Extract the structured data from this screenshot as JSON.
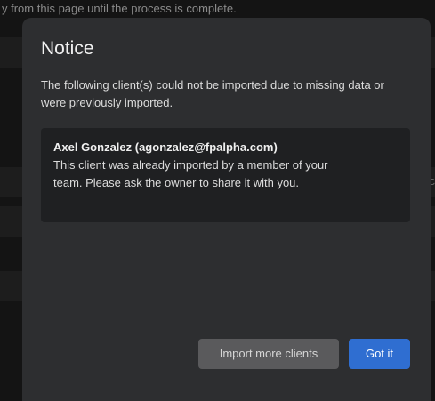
{
  "backdrop": {
    "top_text": "y from this page until the process is complete.",
    "edge_char": "c"
  },
  "modal": {
    "title": "Notice",
    "message": "The following client(s) could not be imported due to missing data or were previously imported.",
    "error": {
      "client": "Axel Gonzalez (agonzalez@fpalpha.com)",
      "detail": "This client was already imported by a member of your team. Please ask the owner to share it with you."
    },
    "buttons": {
      "import_more": "Import more clients",
      "got_it": "Got it"
    }
  },
  "colors": {
    "modal_background": "#2d2e30",
    "card_background": "#1f2022",
    "primary": "#2f6ed1",
    "secondary": "#5a5a5c"
  }
}
